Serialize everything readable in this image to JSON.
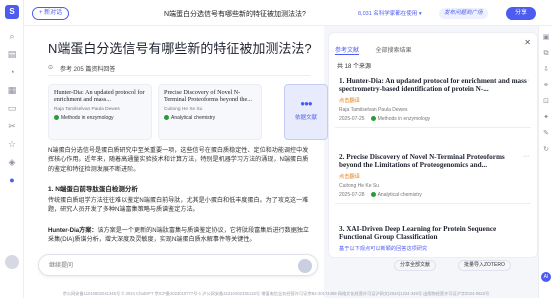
{
  "topbar": {
    "new_chat": "+ 新对话",
    "title": "N端蛋白分选信号有哪些新的特征被加测法法?",
    "usage_badge": "8,031 名科学家都在使用 ▾",
    "share_plaza": "发布问题到广场",
    "share": "分享"
  },
  "main": {
    "title": "N端蛋白分选信号有哪些新的特征被加测法法?",
    "ref_bar": "参考 205 篇资料回答",
    "ref_cards": [
      {
        "title": "Hunter-Dia: An updated protocol for enrichment and mass...",
        "authors": "Raja Tamilselvan   Paula Dewes",
        "journal": "Methods in enzymology"
      },
      {
        "title": "Precise Discovery of Novel N-Terminal Proteoforms beyond the...",
        "authors": "Cuitong He   Xe Su",
        "journal": "Analytical chemistry"
      }
    ],
    "more_refs": "依据文献",
    "para1": "N端蛋白分选信号是蛋白质研究中至关重要一项，这些信号在蛋白质稳定性、定位和功能调控中发挥核心作用。近年来，随着高通量实验技术和计算方法，特别是机器学习方法的涌现，N端蛋白质的鉴定和特征检测发展不断进阶。",
    "section1": "1. N端蛋白前导肽蛋白检测分析",
    "para2": "传统蛋白质组学方法往往难以鉴定N端蛋白前导肽，尤其是小蛋白和低丰度蛋白。为了攻克这一难题，研究人员开发了多种N端富集策略与质谱鉴定方法。",
    "para3_head": "Hunter-Dia方案：",
    "para3": "该方案是一个更新的N端肽富集与质谱鉴定协议，它将肽段富集后进行数据独立采集(DIA)质谱分析，增大深度及灵敏度，实现N端蛋白质水解事件等关键性。",
    "chat_placeholder": "继续提问"
  },
  "rpanel": {
    "tabs": [
      "参考文献",
      "全部搜索结果"
    ],
    "count": "共 18 个来源",
    "items": [
      {
        "title": "1. Hunter-Dia: An updated protocol for enrichment and mass spectrometry-based identification of protein N-...",
        "cite": "点击翻译",
        "authors": "Raja Tamilselvan   Paula Dewes",
        "date": "2025-07-25",
        "journal": "Methods in enzymology"
      },
      {
        "title": "2. Precise Discovery of Novel N-Terminal Proteoforms beyond the Limitations of Proteogenomics and...",
        "cite": "点击翻译",
        "authors": "Cuitong He   Ke Su",
        "date": "2025-07-28",
        "journal": "Analytical chemistry"
      },
      {
        "title": "3. XAI-Driven Deep Learning for Protein Sequence Functional Group Classification",
        "cite": "基于以下观点可以新颖的回答这项研究",
        "authors": "",
        "date": "",
        "journal": ""
      }
    ],
    "footer_left": "分享全部文献",
    "footer_right": "批量导入ZOTERO"
  },
  "footer": "京公网安备11010802041345号  © 2024 ChatGPT  京ICP备2023010777号-1  沪公网安备31010402335133号  增值电信业务经营许可证京B2-20174489  网络文化经营许可证沪网文(2024)1234-345号  出版物经营许可证沪字2024-0523号"
}
